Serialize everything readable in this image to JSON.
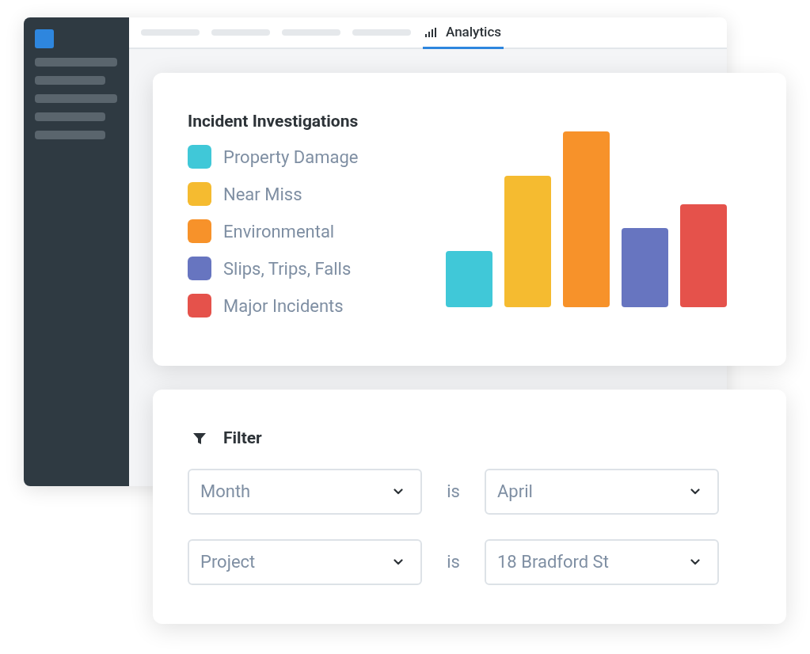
{
  "tabs": [
    {
      "label": "Analytics",
      "selected": true
    }
  ],
  "chart_card": {
    "title": "Incident Investigations",
    "legend": [
      {
        "label": "Property Damage",
        "color": "#40c8d8"
      },
      {
        "label": "Near Miss",
        "color": "#f5bb30"
      },
      {
        "label": "Environmental",
        "color": "#f7922a"
      },
      {
        "label": "Slips, Trips, Falls",
        "color": "#6775c0"
      },
      {
        "label": "Major Incidents",
        "color": "#e5524b"
      }
    ]
  },
  "filter_card": {
    "title": "Filter",
    "rows": [
      {
        "field": "Month",
        "operator": "is",
        "value": "April"
      },
      {
        "field": "Project",
        "operator": "is",
        "value": "18 Bradford St"
      }
    ]
  }
}
